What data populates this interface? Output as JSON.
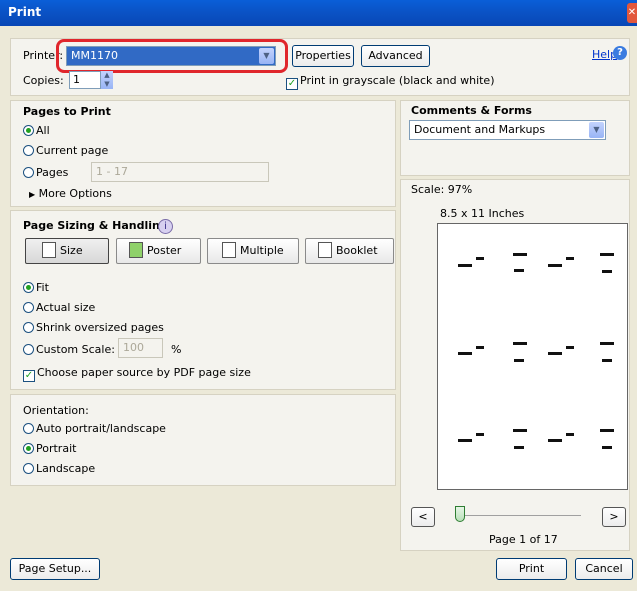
{
  "title": "Print",
  "printer": {
    "label": "Printer:",
    "value": "MM1170"
  },
  "properties_label": "Properties",
  "advanced_label": "Advanced",
  "help_label": "Help",
  "copies": {
    "label": "Copies:",
    "value": "1"
  },
  "grayscale_label": "Print in grayscale (black and white)",
  "pages_to_print": {
    "heading": "Pages to Print",
    "all": "All",
    "current": "Current page",
    "pages": "Pages",
    "pages_range": "1 - 17",
    "more": "More Options"
  },
  "sizing": {
    "heading": "Page Sizing & Handling",
    "size": "Size",
    "poster": "Poster",
    "multiple": "Multiple",
    "booklet": "Booklet",
    "fit": "Fit",
    "actual": "Actual size",
    "shrink": "Shrink oversized pages",
    "custom": "Custom Scale:",
    "custom_value": "100",
    "percent": "%",
    "paper_source": "Choose paper source by PDF page size"
  },
  "orientation": {
    "heading": "Orientation:",
    "auto": "Auto portrait/landscape",
    "portrait": "Portrait",
    "landscape": "Landscape"
  },
  "comments": {
    "heading": "Comments & Forms",
    "value": "Document and Markups"
  },
  "scale": "Scale:  97%",
  "paper": "8.5 x 11 Inches",
  "page_indicator": "Page 1 of 17",
  "page_setup_label": "Page Setup...",
  "print_label": "Print",
  "cancel_label": "Cancel",
  "nav": {
    "prev": "<",
    "next": ">"
  },
  "colors": {
    "highlight": "#e0262c",
    "accent": "#316ac5"
  }
}
